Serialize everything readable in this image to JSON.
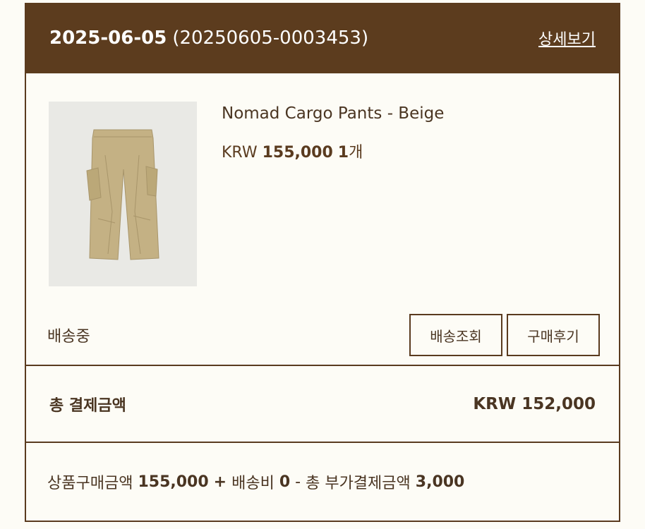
{
  "order": {
    "date": "2025-06-05",
    "number": "(20250605-0003453)",
    "detail_link": "상세보기"
  },
  "item": {
    "name": "Nomad Cargo Pants - Beige",
    "currency": "KRW",
    "price": "155,000",
    "quantity": "1",
    "quantity_unit": "개",
    "image_alt": "beige cargo pants"
  },
  "status": "배송중",
  "buttons": {
    "track": "배송조회",
    "review": "구매후기"
  },
  "total": {
    "label": "총 결제금액",
    "amount": "KRW 152,000"
  },
  "breakdown": {
    "product_label": "상품구매금액",
    "product_amount": "155,000",
    "plus": "+",
    "shipping_label": "배송비",
    "shipping_amount": "0",
    "minus": "-",
    "extra_label": "총 부가결제금액",
    "extra_amount": "3,000"
  },
  "colors": {
    "header_bg": "#5c3c1e",
    "border": "#5a3b1f",
    "page_bg": "#fdfcf6",
    "product_bg": "#e9e9e5",
    "pants": "#c4b184"
  }
}
